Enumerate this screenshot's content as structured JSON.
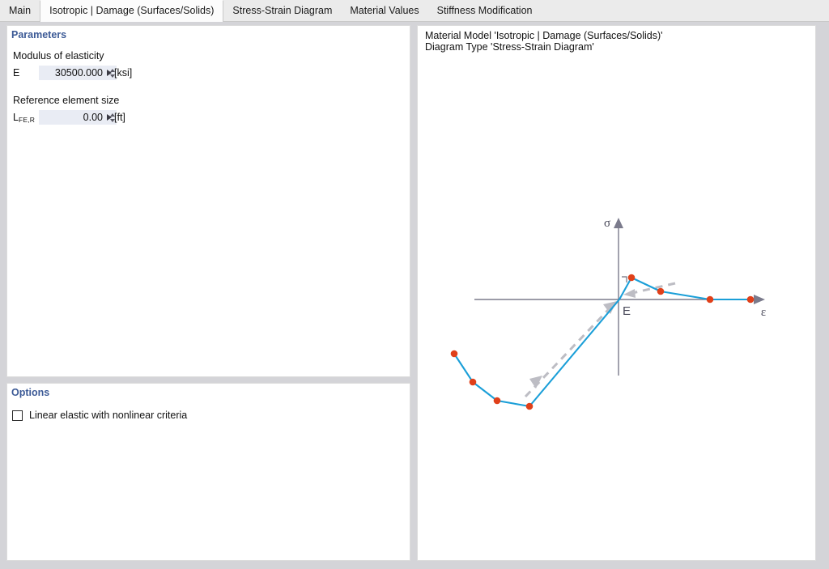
{
  "tabs": [
    {
      "label": "Main",
      "active": false
    },
    {
      "label": "Isotropic | Damage (Surfaces/Solids)",
      "active": true
    },
    {
      "label": "Stress-Strain Diagram",
      "active": false
    },
    {
      "label": "Material Values",
      "active": false
    },
    {
      "label": "Stiffness Modification",
      "active": false
    }
  ],
  "parameters": {
    "group_title": "Parameters",
    "modulus": {
      "section_label": "Modulus of elasticity",
      "symbol": "E",
      "value": "30500.000",
      "unit": "[ksi]"
    },
    "reference_element_size": {
      "section_label": "Reference element size",
      "symbol_base": "L",
      "symbol_sub": "FE,R",
      "value": "0.00",
      "unit": "[ft]"
    }
  },
  "options": {
    "group_title": "Options",
    "linear_elastic": {
      "label": "Linear elastic with nonlinear criteria",
      "checked": false
    }
  },
  "diagram": {
    "header_line1": "Material Model 'Isotropic | Damage (Surfaces/Solids)'",
    "header_line2": "Diagram Type 'Stress-Strain Diagram'",
    "material_model": "Isotropic | Damage (Surfaces/Solids)",
    "diagram_type": "Stress-Strain Diagram",
    "y_axis_label": "σ",
    "x_axis_label": "ε",
    "slope_label": "E",
    "colors": {
      "curve": "#1b9fd8",
      "point": "#e0401a",
      "axis": "#7b7b8c",
      "guide": "#bdbdc4"
    }
  },
  "chart_data": {
    "type": "line",
    "title": "Stress-Strain Diagram",
    "xlabel": "ε",
    "ylabel": "σ",
    "grid": false,
    "legend": null,
    "annotations": [
      {
        "text": "E",
        "meaning": "initial elastic modulus slope at origin",
        "x": 0,
        "y": 0
      },
      {
        "text": "right-angle-marker",
        "meaning": "perpendicular symbol at origin"
      },
      {
        "text": "dashed-unloading-arrow-tension",
        "meaning": "dashed arrow pointing back toward origin in tension branch"
      },
      {
        "text": "dashed-unloading-arrow-compression",
        "meaning": "dashed arrow pointing from compression branch toward origin"
      }
    ],
    "series": [
      {
        "name": "Stress-Strain Curve",
        "marker": "circle",
        "points": [
          {
            "x": -0.011,
            "y": -0.34
          },
          {
            "x": -0.0083,
            "y": -0.48
          },
          {
            "x": -0.0053,
            "y": -0.57
          },
          {
            "x": -0.002,
            "y": -0.6
          },
          {
            "x": 0.0007,
            "y": 0.28
          },
          {
            "x": 0.0043,
            "y": 0.17
          },
          {
            "x": 0.012,
            "y": 0.0
          },
          {
            "x": 0.0167,
            "y": 0.0
          }
        ]
      }
    ],
    "xlim": [
      -0.014,
      0.0195
    ],
    "ylim": [
      -0.7,
      0.45
    ]
  }
}
